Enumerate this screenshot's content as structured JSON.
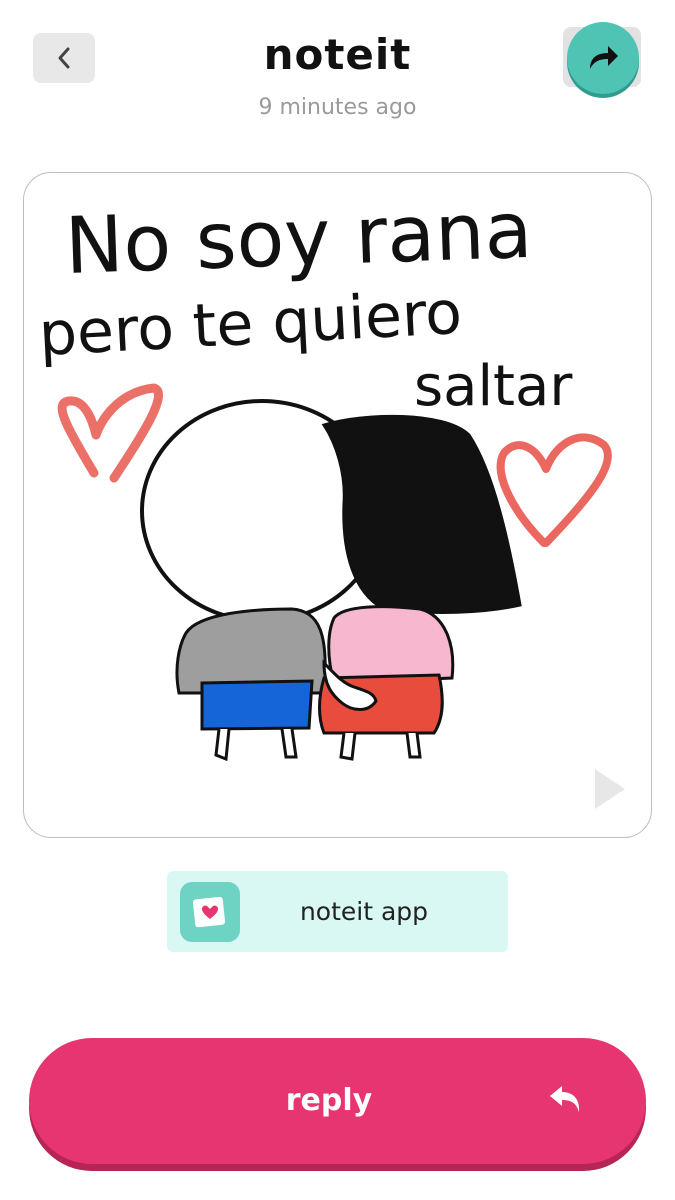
{
  "header": {
    "title": "noteit",
    "time": "9 minutes ago",
    "back_icon": "chevron-left-icon",
    "share_icon": "share-forward-icon"
  },
  "note": {
    "handwritten_text": [
      "No soy rana",
      "pero te quiero",
      "saltar"
    ],
    "play_icon": "play-icon"
  },
  "app_chip": {
    "label": "noteit app",
    "icon": "noteit-app-icon"
  },
  "reply": {
    "label": "reply",
    "icon": "reply-arrow-icon"
  },
  "colors": {
    "accent_teal": "#4fc3b4",
    "reply_pink": "#e63570",
    "chip_bg": "#d9f7f3",
    "heart_red": "#e8584e"
  }
}
